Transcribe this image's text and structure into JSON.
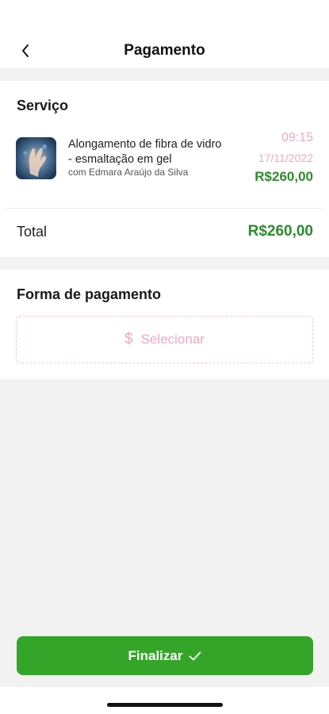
{
  "header": {
    "title": "Pagamento",
    "back_icon": "chevron-left-icon"
  },
  "service": {
    "section_title": "Serviço",
    "name": "Alongamento de fibra de vidro - esmaltação em gel",
    "professional": "com Edmara Araújo da Silva",
    "time": "09:15",
    "date": "17/11/2022",
    "price": "R$260,00",
    "total_label": "Total",
    "total_value": "R$260,00"
  },
  "payment": {
    "section_title": "Forma de pagamento",
    "select_icon": "dollar-icon",
    "select_label": "Selecionar"
  },
  "footer": {
    "finalize_label": "Finalizar",
    "finalize_icon": "check-icon"
  },
  "colors": {
    "accent_green": "#35a52a",
    "price_green": "#2e8b2e",
    "pink": "#f0a8c2"
  }
}
